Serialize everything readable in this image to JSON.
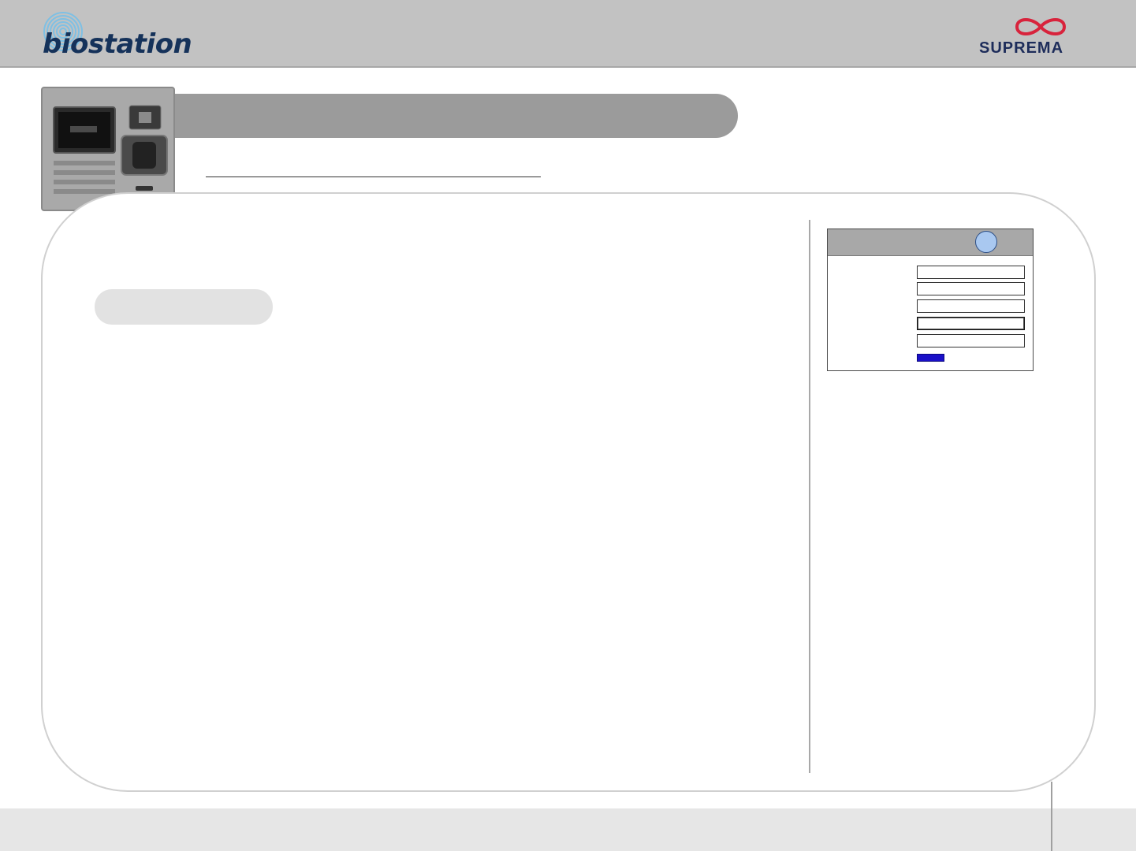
{
  "header": {
    "brand_logo_text": "biostation",
    "company_logo_text": "SUPREMA"
  },
  "title_bar": {
    "title": ""
  },
  "subtitle": {
    "text": ""
  },
  "section": {
    "label": ""
  },
  "dialog": {
    "title": "",
    "badge_text": "",
    "rows": [
      {
        "label": "",
        "value": ""
      },
      {
        "label": "",
        "value": ""
      },
      {
        "label": "",
        "value": ""
      },
      {
        "label": "",
        "value": ""
      },
      {
        "label": "",
        "value": ""
      }
    ],
    "button_label": ""
  },
  "footer": {
    "page_number": ""
  },
  "colors": {
    "header_bg": "#c2c2c2",
    "title_bar_bg": "#9b9b9b",
    "section_pill_bg": "#e2e2e2",
    "dialog_title_bg": "#a8a8a8",
    "badge_fill": "#a9c8f0",
    "button_fill": "#1a10c8",
    "footer_bg": "#e6e6e6",
    "brand_navy": "#1d2c5a",
    "brand_red": "#d8233c"
  },
  "icons": {
    "brand_mark": "fingerprint-icon",
    "company_mark": "infinity-icon",
    "device_image": "biostation-device-icon"
  }
}
